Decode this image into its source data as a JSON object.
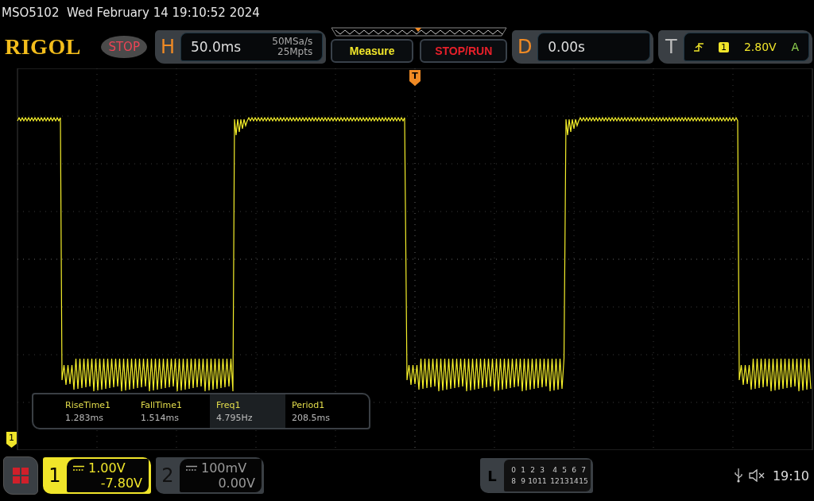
{
  "header": {
    "model": "MSO5102",
    "datetime": "Wed February 14 19:10:52 2024"
  },
  "toolbar": {
    "logo": "RIGOL",
    "run_state": "STOP",
    "horizontal": {
      "label": "H",
      "timebase": "50.0ms",
      "sample_rate": "50MSa/s",
      "memory_depth": "25Mpts"
    },
    "buttons": [
      {
        "label": "Measure",
        "kind": "measure"
      },
      {
        "label": "STOP/RUN",
        "kind": "stoprun"
      }
    ],
    "delay": {
      "label": "D",
      "value": "0.00s"
    },
    "trigger": {
      "label": "T",
      "source": "1",
      "level": "2.80V",
      "mode": "A"
    }
  },
  "trigger_marker": "T",
  "channel_marker": "1",
  "measurements": [
    {
      "name": "RiseTime1",
      "value": "1.283ms",
      "selected": false
    },
    {
      "name": "FallTime1",
      "value": "1.514ms",
      "selected": false
    },
    {
      "name": "Freq1",
      "value": "4.795Hz",
      "selected": true
    },
    {
      "name": "Period1",
      "value": "208.5ms",
      "selected": false
    }
  ],
  "channels": [
    {
      "number": "1",
      "scale": "1.00V",
      "offset": "-7.80V",
      "selected": true
    },
    {
      "number": "2",
      "scale": "100mV",
      "offset": "0.00V",
      "selected": false
    }
  ],
  "logic": {
    "label": "L",
    "rows": [
      [
        "0",
        "1",
        "2",
        "3",
        "4",
        "5",
        "6",
        "7"
      ],
      [
        "8",
        "9",
        "10",
        "11",
        "12",
        "13",
        "14",
        "15"
      ]
    ]
  },
  "status": {
    "time": "19:10"
  }
}
